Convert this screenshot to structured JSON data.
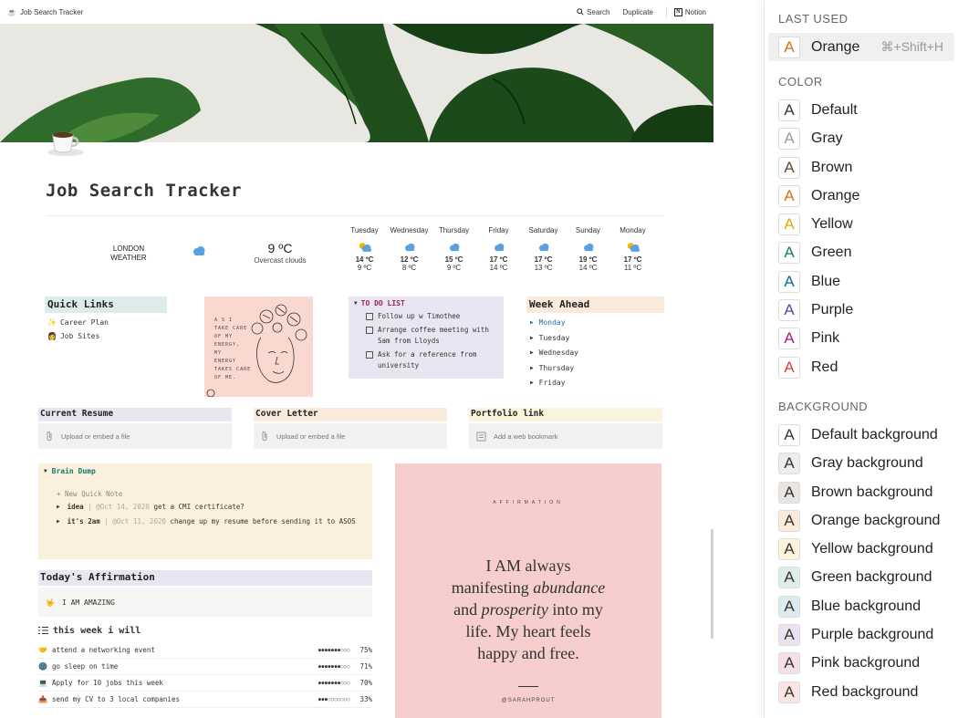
{
  "topbar": {
    "title": "Job Search Tracker",
    "search": "Search",
    "duplicate": "Duplicate",
    "notion": "Notion"
  },
  "page": {
    "title": "Job Search Tracker",
    "icon": "coffee-cup-icon"
  },
  "weather": {
    "city": "LONDON",
    "label": "WEATHER",
    "temp": "9 ºC",
    "desc": "Overcast clouds",
    "forecast": [
      {
        "day": "Tuesday",
        "hi": "14 ºC",
        "lo": "9 ºC",
        "icon": "sun-cloud"
      },
      {
        "day": "Wednesday",
        "hi": "12 ºC",
        "lo": "8 ºC",
        "icon": "cloud"
      },
      {
        "day": "Thursday",
        "hi": "15 ºC",
        "lo": "9 ºC",
        "icon": "cloud"
      },
      {
        "day": "Friday",
        "hi": "17 ºC",
        "lo": "14 ºC",
        "icon": "cloud"
      },
      {
        "day": "Saturday",
        "hi": "17 ºC",
        "lo": "13 ºC",
        "icon": "cloud"
      },
      {
        "day": "Sunday",
        "hi": "19 ºC",
        "lo": "14 ºC",
        "icon": "cloud"
      },
      {
        "day": "Monday",
        "hi": "17 ºC",
        "lo": "11 ºC",
        "icon": "sun-cloud"
      }
    ]
  },
  "quick_links": {
    "title": "Quick Links",
    "items": [
      {
        "emoji": "✨",
        "label": "Career Plan"
      },
      {
        "emoji": "👩",
        "label": "Job Sites"
      }
    ]
  },
  "sketch": {
    "lines": [
      "A S  I",
      "TAKE CARE",
      "OF  MY",
      "ENERGY,",
      "MY",
      "ENERGY",
      "TAKES CARE",
      "OF  ME."
    ]
  },
  "todo": {
    "title": "TO DO LIST",
    "items": [
      "Follow up w Timothee",
      "Arrange coffee meeting with Sam from Lloyds",
      "Ask for a reference from university"
    ]
  },
  "week_ahead": {
    "title": "Week Ahead",
    "days": [
      "Monday",
      "Tuesday",
      "Wednesday",
      "Thursday",
      "Friday"
    ],
    "highlight_color": "#2a6fb0"
  },
  "resume": {
    "title": "Current Resume",
    "placeholder": "Upload or embed a file"
  },
  "cover": {
    "title": "Cover Letter",
    "placeholder": "Upload or embed a file"
  },
  "portfolio": {
    "title": "Portfolio link",
    "placeholder": "Add a web bookmark"
  },
  "brain_dump": {
    "title": "Brain Dump",
    "new_note": "+ New Quick Note",
    "items": [
      {
        "tag": "idea",
        "date": "@Oct 14, 2020",
        "text": "get a CMI certificate?"
      },
      {
        "tag": "it's 2am",
        "date": "@Oct 11, 2020",
        "text": "change up my resume before sending it to ASOS"
      }
    ]
  },
  "affirmation_card": {
    "label": "AFFIRMATION",
    "quote_lines": [
      "I AM always",
      "manifesting |abundance|",
      "and |prosperity| into my",
      "life. My heart feels",
      "happy and free."
    ],
    "handle": "@SARAHPROUT"
  },
  "todays_affirmation": {
    "title": "Today's Affirmation",
    "emoji": "🤟",
    "text": "I AM AMAZING"
  },
  "this_week": {
    "title": "this week i will",
    "items": [
      {
        "emoji": "🤝",
        "label": "attend a networking event",
        "dots": "●●●●●●●○○○",
        "pct": "75%"
      },
      {
        "emoji": "🌚",
        "label": "go sleep on time",
        "dots": "●●●●●●●○○○",
        "pct": "71%"
      },
      {
        "emoji": "💻",
        "label": "Apply for 10 jobs this week",
        "dots": "●●●●●●●○○○",
        "pct": "70%"
      },
      {
        "emoji": "📤",
        "label": "send my CV to 3 local companies",
        "dots": "●●●○○○○○○○",
        "pct": "33%"
      }
    ]
  },
  "menu": {
    "last_used_label": "LAST USED",
    "last_used": {
      "label": "Orange",
      "shortcut": "⌘+Shift+H",
      "color": "#d9730d",
      "bg": "#ffffff"
    },
    "color_label": "COLOR",
    "colors": [
      {
        "label": "Default",
        "color": "#37352f",
        "bg": "#ffffff"
      },
      {
        "label": "Gray",
        "color": "#9b9a97",
        "bg": "#ffffff"
      },
      {
        "label": "Brown",
        "color": "#64473a",
        "bg": "#ffffff"
      },
      {
        "label": "Orange",
        "color": "#d9730d",
        "bg": "#ffffff"
      },
      {
        "label": "Yellow",
        "color": "#dfab01",
        "bg": "#ffffff"
      },
      {
        "label": "Green",
        "color": "#0f7b6c",
        "bg": "#ffffff"
      },
      {
        "label": "Blue",
        "color": "#0b6e99",
        "bg": "#ffffff"
      },
      {
        "label": "Purple",
        "color": "#6940a5",
        "bg": "#ffffff"
      },
      {
        "label": "Pink",
        "color": "#ad1a72",
        "bg": "#ffffff"
      },
      {
        "label": "Red",
        "color": "#e03e3e",
        "bg": "#ffffff"
      }
    ],
    "background_label": "BACKGROUND",
    "backgrounds": [
      {
        "label": "Default background",
        "color": "#37352f",
        "bg": "#ffffff"
      },
      {
        "label": "Gray background",
        "color": "#37352f",
        "bg": "#ebeced"
      },
      {
        "label": "Brown background",
        "color": "#37352f",
        "bg": "#e9e5e3"
      },
      {
        "label": "Orange background",
        "color": "#37352f",
        "bg": "#faebdd"
      },
      {
        "label": "Yellow background",
        "color": "#37352f",
        "bg": "#fbf3db"
      },
      {
        "label": "Green background",
        "color": "#37352f",
        "bg": "#ddedea"
      },
      {
        "label": "Blue background",
        "color": "#37352f",
        "bg": "#ddebf1"
      },
      {
        "label": "Purple background",
        "color": "#37352f",
        "bg": "#eae4f2"
      },
      {
        "label": "Pink background",
        "color": "#37352f",
        "bg": "#f4dfeb"
      },
      {
        "label": "Red background",
        "color": "#37352f",
        "bg": "#fbe4e4"
      }
    ]
  }
}
